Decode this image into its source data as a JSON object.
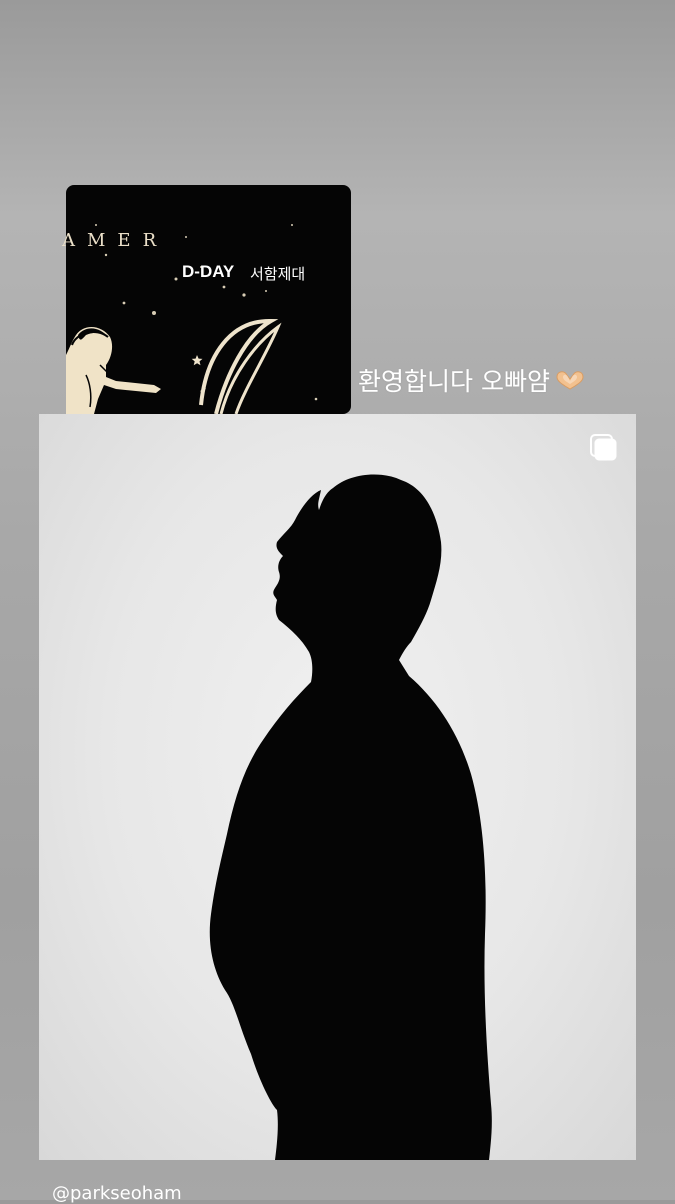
{
  "poster": {
    "word": "AMER",
    "dday": "D-DAY",
    "korean_title": "서함제대"
  },
  "caption": {
    "text": "환영합니다 오빠얌",
    "emoji_icon": "heart-hands-emoji"
  },
  "photo": {
    "subject": "silhouette-portrait",
    "overlay_icon": "multiple-posts-icon"
  },
  "mention": {
    "handle": "@parkseoham"
  }
}
